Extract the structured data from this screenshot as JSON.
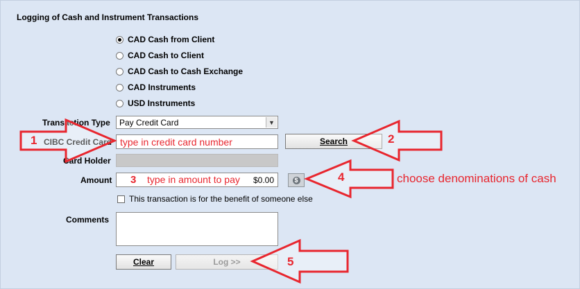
{
  "window": {
    "title": "Logging of Cash and Instrument Transactions"
  },
  "options": [
    {
      "label": "CAD Cash from Client",
      "selected": true
    },
    {
      "label": "CAD Cash to Client",
      "selected": false
    },
    {
      "label": "CAD Cash to Cash Exchange",
      "selected": false
    },
    {
      "label": "CAD Instruments",
      "selected": false
    },
    {
      "label": "USD Instruments",
      "selected": false
    }
  ],
  "form": {
    "transaction_type_label": "Transaction Type",
    "transaction_type_value": "Pay Credit Card",
    "credit_card_label": "CIBC Credit Card",
    "credit_card_hint": "type in credit card number",
    "card_holder_label": "Card Holder",
    "amount_label": "Amount",
    "amount_value": "$0.00",
    "benefit_label": "This transaction is for the benefit of someone else",
    "comments_label": "Comments"
  },
  "buttons": {
    "search": "Search",
    "clear": "Clear",
    "log": "Log >>"
  },
  "annotations": {
    "n1": "1",
    "n2": "2",
    "n3": "3",
    "n3_text": "type in amount to pay",
    "n4": "4",
    "n4_text": "choose denominations of cash",
    "n5": "5"
  },
  "icons": {
    "dropdown": "chevron-down-icon",
    "money": "cash-icon"
  },
  "colors": {
    "annotation": "#e8262e",
    "panel": "#dce6f4"
  }
}
